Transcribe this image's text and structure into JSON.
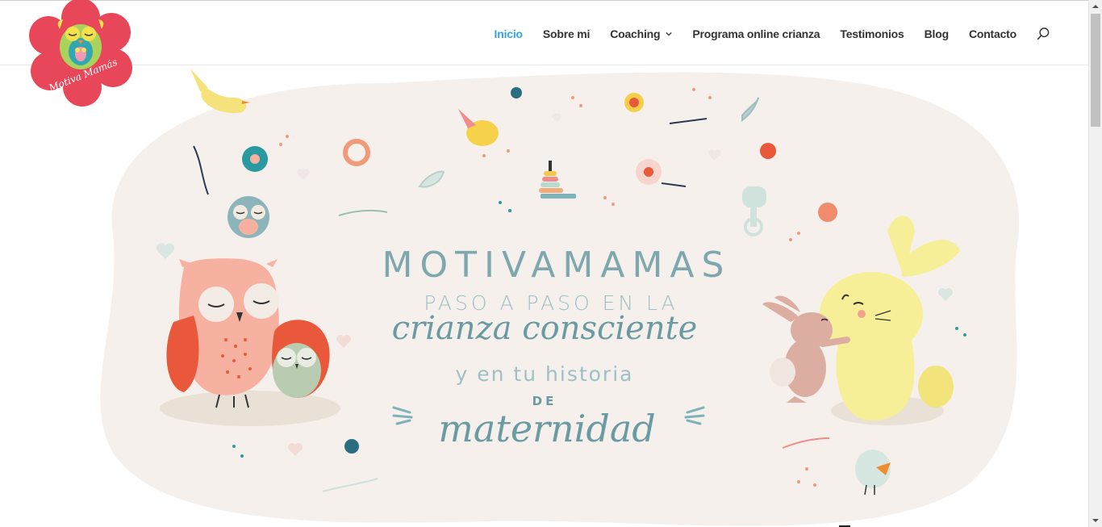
{
  "logo": {
    "text": "Motiva Mamás"
  },
  "nav": {
    "items": [
      {
        "label": "Inicio",
        "active": true
      },
      {
        "label": "Sobre mi"
      },
      {
        "label": "Coaching",
        "has_dropdown": true
      },
      {
        "label": "Programa online crianza"
      },
      {
        "label": "Testimonios"
      },
      {
        "label": "Blog"
      },
      {
        "label": "Contacto"
      }
    ],
    "search_icon": "search-icon"
  },
  "hero": {
    "title": "MOTIVAMAMAS",
    "line1": "PASO A PASO EN LA",
    "line2": "crianza consciente",
    "line3": "y en tu historia",
    "line4": "DE",
    "line5": "maternidad"
  },
  "colors": {
    "accent": "#2ea3f2",
    "nav_text": "#333333",
    "title": "#7ea7ae",
    "blob": "#f5f0ec",
    "logo_flower": "#e8475a"
  }
}
